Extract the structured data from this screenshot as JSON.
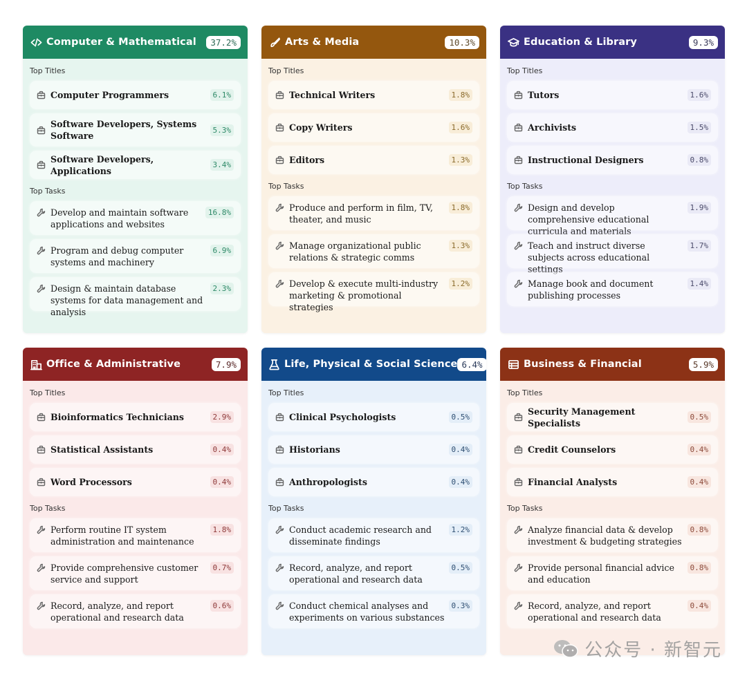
{
  "section_labels": {
    "titles": "Top Titles",
    "tasks": "Top Tasks"
  },
  "cards": [
    {
      "title": "Computer & Mathematical",
      "share": "37.2%",
      "icon": "code-icon",
      "colors": {
        "header": "#1E8A63",
        "body": "#E6F5EF",
        "pct_text": "#2F8A68",
        "pct_bg": "#E2F3EC",
        "badge_text": "#2F6B57"
      },
      "titles": [
        {
          "label": "Computer Programmers",
          "pct": "6.1%"
        },
        {
          "label": "Software Developers, Systems Software",
          "pct": "5.3%"
        },
        {
          "label": "Software Developers, Applications",
          "pct": "3.4%"
        }
      ],
      "tasks": [
        {
          "label": "Develop and maintain software applications and websites",
          "pct": "16.8%"
        },
        {
          "label": "Program and debug computer systems and machinery",
          "pct": "6.9%"
        },
        {
          "label": "Design & maintain database systems for data management and analysis",
          "pct": "2.3%"
        }
      ]
    },
    {
      "title": "Arts & Media",
      "share": "10.3%",
      "icon": "brush-icon",
      "colors": {
        "header": "#94570E",
        "body": "#FBF1E3",
        "pct_text": "#8A6A2A",
        "pct_bg": "#F8EDD8",
        "badge_text": "#5E4A2A"
      },
      "titles": [
        {
          "label": "Technical Writers",
          "pct": "1.8%"
        },
        {
          "label": "Copy Writers",
          "pct": "1.6%"
        },
        {
          "label": "Editors",
          "pct": "1.3%"
        }
      ],
      "tasks": [
        {
          "label": "Produce and perform in film, TV, theater, and music",
          "pct": "1.8%"
        },
        {
          "label": "Manage organizational public relations & strategic comms",
          "pct": "1.3%"
        },
        {
          "label": "Develop & execute multi-industry marketing & promotional strategies",
          "pct": "1.2%"
        }
      ]
    },
    {
      "title": "Education & Library",
      "share": "9.3%",
      "icon": "graduation-cap-icon",
      "colors": {
        "header": "#3A3183",
        "body": "#EDEDFA",
        "pct_text": "#4A4A6A",
        "pct_bg": "#EAEAF6",
        "badge_text": "#3A3A5A"
      },
      "titles": [
        {
          "label": "Tutors",
          "pct": "1.6%"
        },
        {
          "label": "Archivists",
          "pct": "1.5%"
        },
        {
          "label": "Instructional Designers",
          "pct": "0.8%"
        }
      ],
      "tasks": [
        {
          "label": "Design and develop comprehensive educational curricula and materials",
          "pct": "1.9%"
        },
        {
          "label": "Teach and instruct diverse subjects across educational settings",
          "pct": "1.7%"
        },
        {
          "label": "Manage book and document publishing processes",
          "pct": "1.4%"
        }
      ]
    },
    {
      "title": "Office & Administrative",
      "share": "7.9%",
      "icon": "office-building-icon",
      "colors": {
        "header": "#8E2424",
        "body": "#FBE9E9",
        "pct_text": "#8E3A3A",
        "pct_bg": "#F8E2E2",
        "badge_text": "#5A2A2A"
      },
      "titles": [
        {
          "label": "Bioinformatics Technicians",
          "pct": "2.9%"
        },
        {
          "label": "Statistical Assistants",
          "pct": "0.4%"
        },
        {
          "label": "Word Processors",
          "pct": "0.4%"
        }
      ],
      "tasks": [
        {
          "label": "Perform routine IT system administration and maintenance",
          "pct": "1.8%"
        },
        {
          "label": "Provide comprehensive customer service and support",
          "pct": "0.7%"
        },
        {
          "label": "Record, analyze, and report operational and research data",
          "pct": "0.6%"
        }
      ]
    },
    {
      "title": "Life, Physical & Social Science",
      "share": "6.4%",
      "icon": "flask-icon",
      "colors": {
        "header": "#124A8A",
        "body": "#E7F0FA",
        "pct_text": "#2E4E72",
        "pct_bg": "#E4EEF8",
        "badge_text": "#2A3A5A"
      },
      "titles": [
        {
          "label": "Clinical Psychologists",
          "pct": "0.5%"
        },
        {
          "label": "Historians",
          "pct": "0.4%"
        },
        {
          "label": "Anthropologists",
          "pct": "0.4%"
        }
      ],
      "tasks": [
        {
          "label": "Conduct academic research and disseminate findings",
          "pct": "1.2%"
        },
        {
          "label": "Record, analyze, and report operational and research data",
          "pct": "0.5%"
        },
        {
          "label": "Conduct chemical analyses and experiments on various substances",
          "pct": "0.3%"
        }
      ]
    },
    {
      "title": "Business & Financial",
      "share": "5.9%",
      "icon": "ledger-icon",
      "colors": {
        "header": "#8C3216",
        "body": "#FBEDE7",
        "pct_text": "#8C4A3A",
        "pct_bg": "#F8E6DF",
        "badge_text": "#5A3A2A"
      },
      "titles": [
        {
          "label": "Security Management Specialists",
          "pct": "0.5%"
        },
        {
          "label": "Credit Counselors",
          "pct": "0.4%"
        },
        {
          "label": "Financial Analysts",
          "pct": "0.4%"
        }
      ],
      "tasks": [
        {
          "label": "Analyze financial data & develop investment & budgeting strategies",
          "pct": "0.8%"
        },
        {
          "label": "Provide personal financial advice and education",
          "pct": "0.8%"
        },
        {
          "label": "Record, analyze, and report operational and research data",
          "pct": "0.4%"
        }
      ]
    }
  ],
  "watermark": {
    "text": "公众号 · 新智元",
    "icon": "wechat-icon"
  }
}
